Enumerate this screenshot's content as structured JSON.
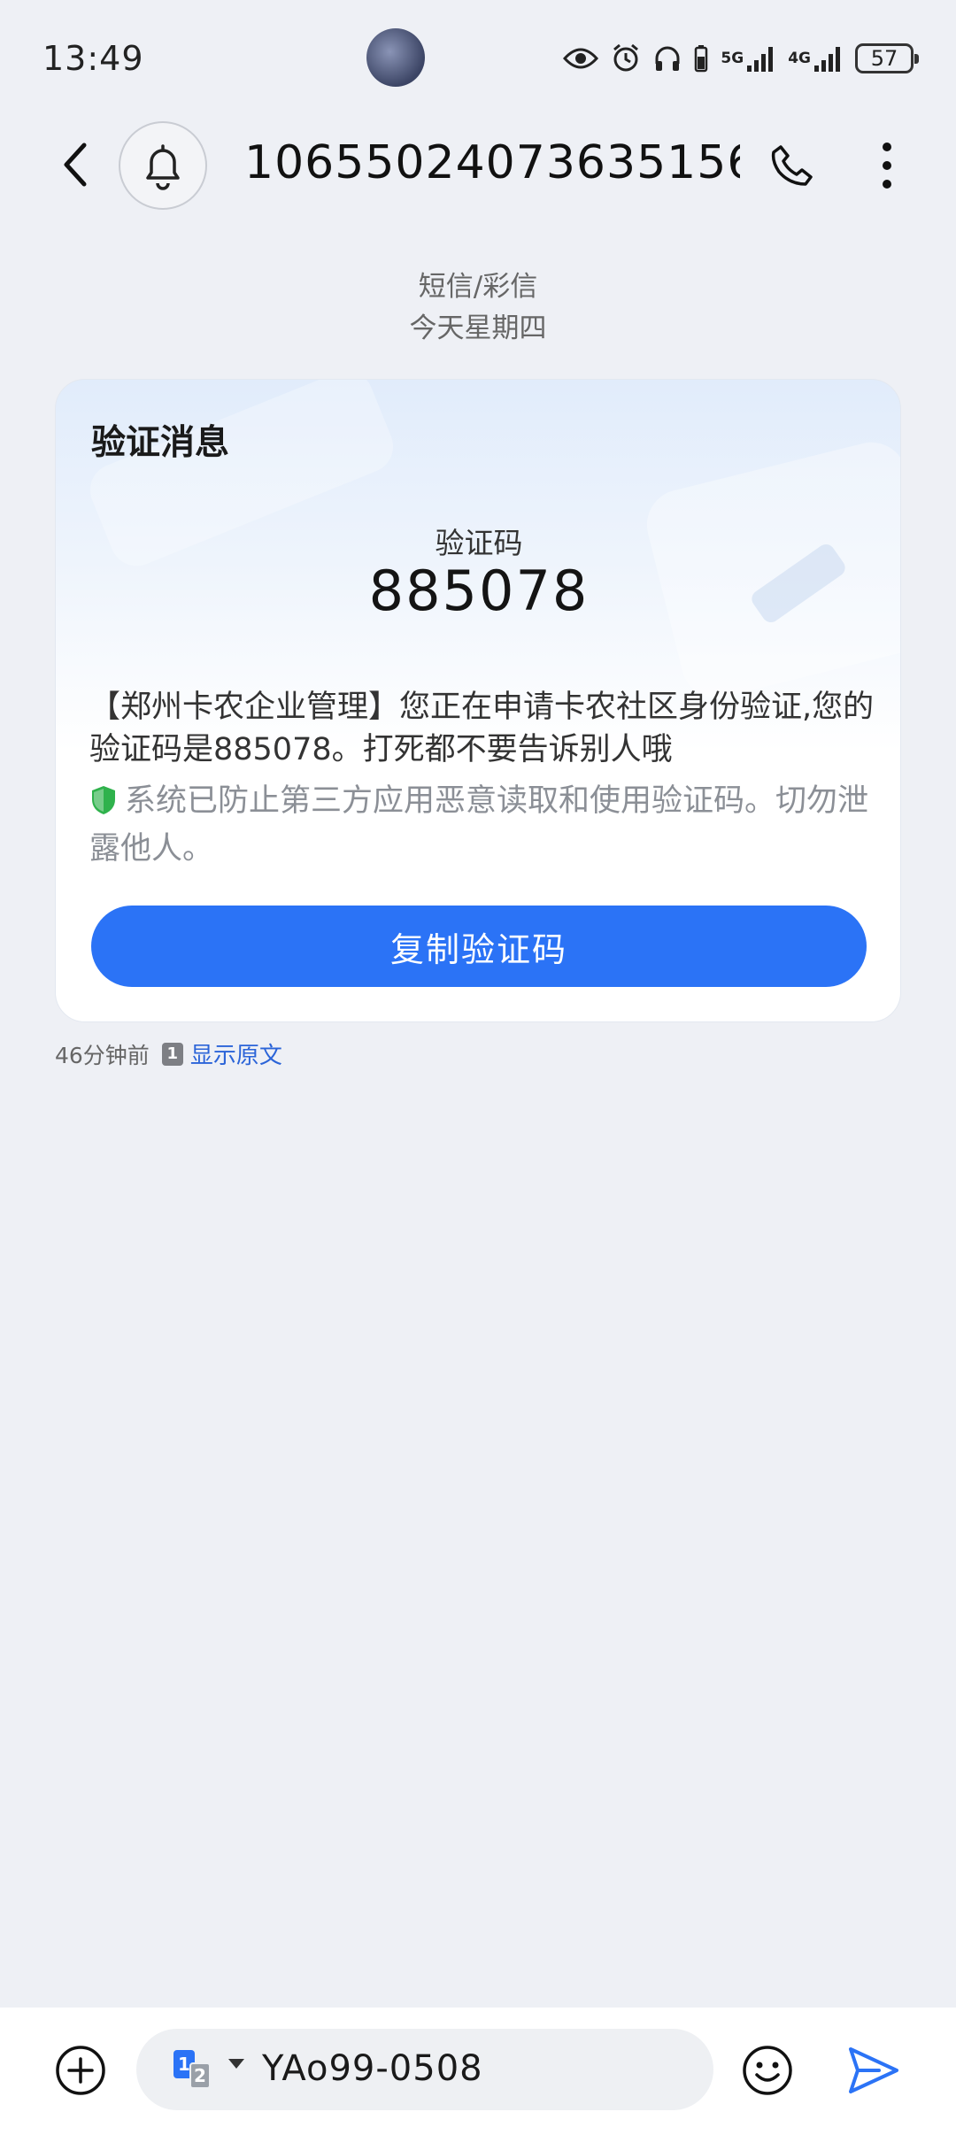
{
  "status_bar": {
    "time": "13:49",
    "network_1": "5G",
    "network_2": "4G",
    "battery": "57"
  },
  "header": {
    "contact": "10655024073635156..."
  },
  "thread": {
    "type": "短信/彩信",
    "date": "今天星期四"
  },
  "card": {
    "title": "验证消息",
    "code_label": "验证码",
    "code_value": "885078",
    "message": "【郑州卡农企业管理】您正在申请卡农社区身份验证,您的验证码是885078。打死都不要告诉别人哦",
    "security_note": "系统已防止第三方应用恶意读取和使用验证码。切勿泄露他人。",
    "copy_button": "复制验证码"
  },
  "message_meta": {
    "time_ago": "46分钟前",
    "sim_slot": "1",
    "show_original": "显示原文"
  },
  "composer": {
    "sim_primary": "1",
    "sim_secondary": "2",
    "text": "YAo99-0508"
  },
  "colors": {
    "accent": "#2b73f6",
    "background": "#eef0f5",
    "link": "#2b64d8",
    "shield": "#2fb24c"
  }
}
